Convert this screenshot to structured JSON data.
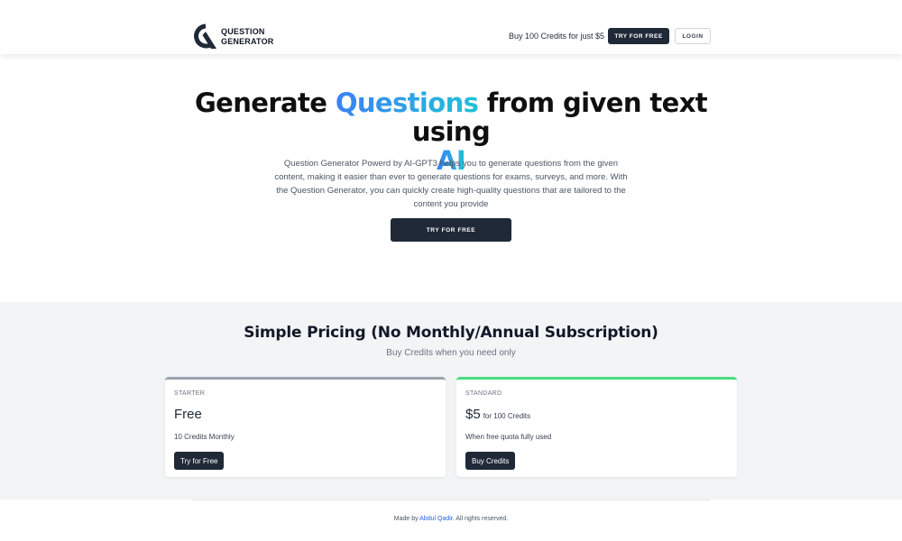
{
  "header": {
    "logo": {
      "line1": "QUESTION",
      "line2": "GENERATOR"
    },
    "promo_text": "Buy 100 Credits for just $5",
    "try_button_label": "TRY FOR FREE",
    "login_button_label": "LOGIN"
  },
  "hero": {
    "title": {
      "part1": "Generate ",
      "highlight1": "Questions",
      "part2": " from given text using",
      "highlight2": "AI"
    },
    "description": "Question Generator Powerd by AI-GPT3 helps you to generate questions from the given content, making it easier than ever to generate questions for exams, surveys, and more. With the Question Generator, you can quickly create high-quality questions that are tailored to the content you provide",
    "cta_label": "TRY FOR FREE"
  },
  "pricing": {
    "title": "Simple Pricing (No Monthly/Annual Subscription)",
    "subtitle": "Buy Credits when you need only",
    "plans": [
      {
        "name": "STARTER",
        "price": "Free",
        "price_suffix": "",
        "note": "10 Credits Monthly",
        "button_label": "Try for Free",
        "accent_color": "#9ca3af"
      },
      {
        "name": "STANDARD",
        "price": "$5",
        "price_suffix": "for 100 Credits",
        "note": "When free quota fully used",
        "button_label": "Buy Credits",
        "accent_color": "#4ade80"
      }
    ]
  },
  "footer": {
    "prefix": "Made by ",
    "author": "Abdul Qadir",
    "suffix": ". All rights reserved."
  },
  "colors": {
    "primary_dark": "#1f2937",
    "gradient_start": "#3b82f6",
    "gradient_end": "#22c1d6",
    "pricing_bg": "#f3f4f6"
  }
}
